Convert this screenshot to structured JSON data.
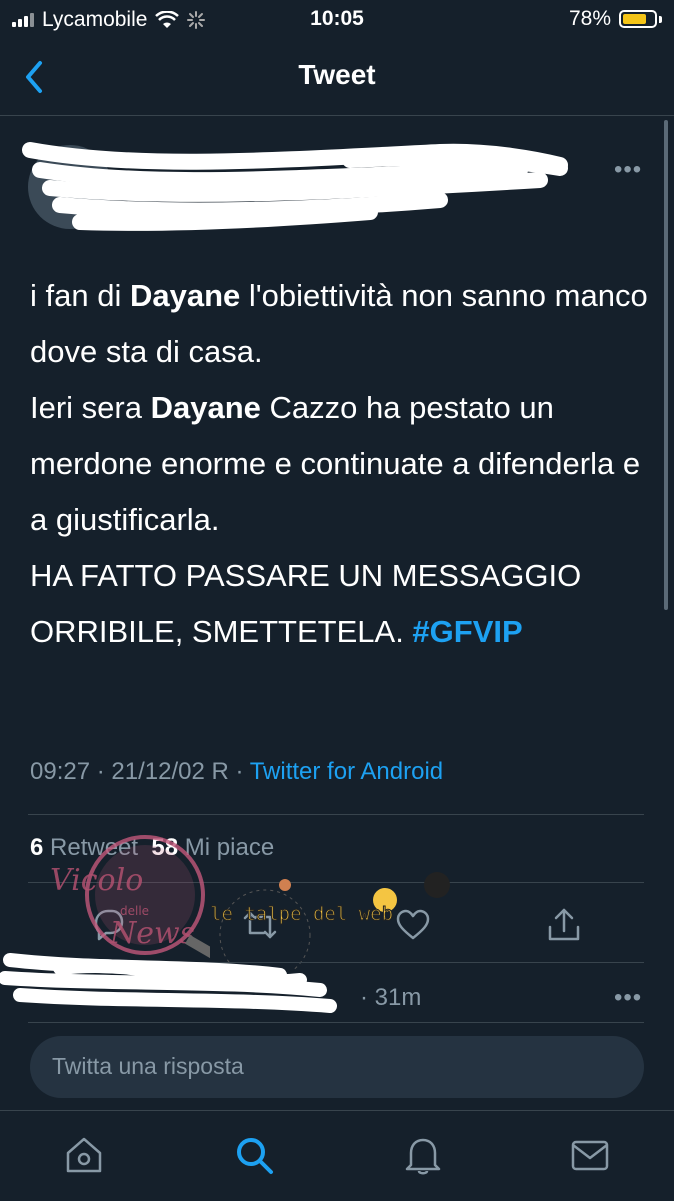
{
  "status_bar": {
    "carrier": "Lycamobile",
    "time": "10:05",
    "battery": "78%",
    "battery_level": 0.78
  },
  "nav": {
    "title": "Tweet"
  },
  "tweet": {
    "text_parts": [
      "i fan di ",
      "Dayane",
      " l'obiettività non sanno manco dove sta di casa.",
      "Ieri sera ",
      "Dayane",
      " Cazzo ha pestato un merdone enorme e continuate a difenderla e a giustificarla.",
      "HA FATTO PASSARE UN MESSAGGIO ORRIBILE, SMETTETELA. ",
      "#GFVIP"
    ],
    "meta_time": "09:27 · 21/12/02 R · ",
    "meta_source": "Twitter for Android",
    "retweets_count": "6",
    "retweets_label": " Retweet",
    "likes_count": "58",
    "likes_label": " Mi piace"
  },
  "reply": {
    "time": "· 31m"
  },
  "compose": {
    "placeholder": "Twitta una risposta"
  },
  "watermarks": {
    "vicolo": "Vicolo delle News",
    "talpe": "le talpe del web"
  },
  "icons": [
    "back-chevron-icon",
    "more-icon",
    "reply-icon",
    "retweet-icon",
    "like-icon",
    "share-icon",
    "home-icon",
    "search-icon",
    "notifications-icon",
    "messages-icon"
  ],
  "colors": {
    "background": "#15202b",
    "accent": "#1da1f2",
    "muted": "#8899a6",
    "divider": "#38444d"
  }
}
